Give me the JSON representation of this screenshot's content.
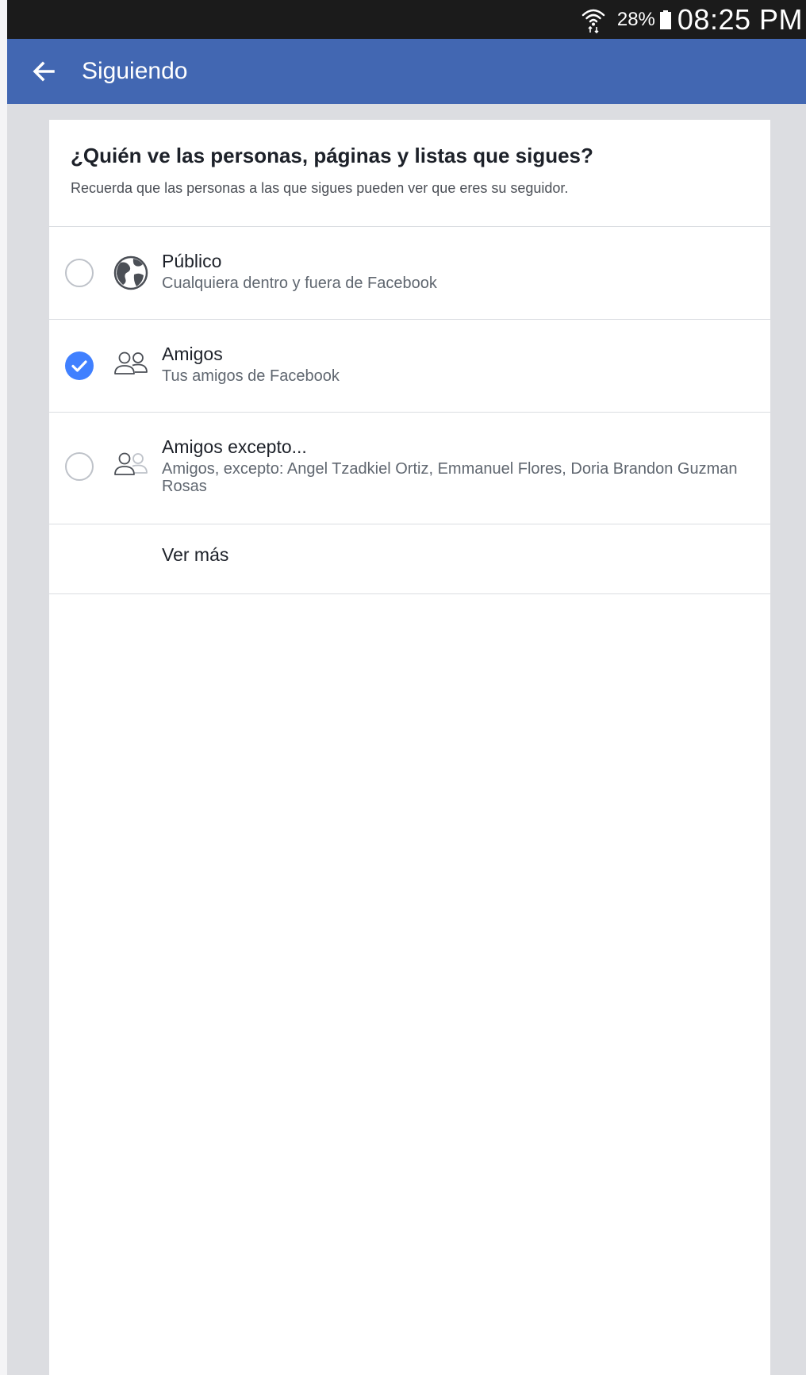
{
  "status_bar": {
    "battery_percent": "28%",
    "time": "08:25 PM"
  },
  "app_bar": {
    "title": "Siguiendo"
  },
  "privacy": {
    "question": "¿Quién ve las personas, páginas y listas que sigues?",
    "reminder": "Recuerda que las personas a las que sigues pueden ver que eres su seguidor.",
    "options": [
      {
        "title": "Público",
        "description": "Cualquiera dentro y fuera de Facebook",
        "icon": "globe-icon",
        "selected": false
      },
      {
        "title": "Amigos",
        "description": "Tus amigos de Facebook",
        "icon": "friends-icon",
        "selected": true
      },
      {
        "title": "Amigos excepto...",
        "description": "Amigos, excepto: Angel Tzadkiel Ortiz, Emmanuel Flores, Doria Brandon Guzman Rosas",
        "icon": "friends-except-icon",
        "selected": false
      }
    ],
    "see_more": "Ver más"
  },
  "colors": {
    "app_bar": "#4267b2",
    "status_bar": "#1b1b1b",
    "selected_radio": "#4080ff",
    "background": "#dcdde1"
  }
}
